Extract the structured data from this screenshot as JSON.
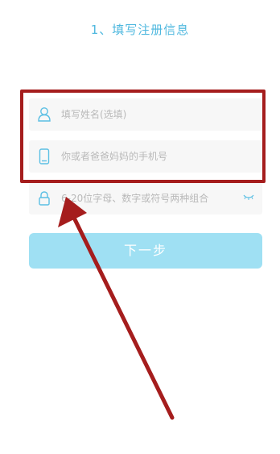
{
  "page": {
    "title": "1、填写注册信息"
  },
  "form": {
    "name_placeholder": "填写姓名(选填)",
    "phone_placeholder": "你或者爸爸妈妈的手机号",
    "password_placeholder": "6-20位字母、数字或符号两种组合",
    "next_button": "下一步"
  },
  "icons": {
    "name": "user-icon",
    "phone": "phone-icon",
    "password": "lock-icon",
    "toggle": "eye-closed-icon"
  },
  "colors": {
    "title": "#4fb8df",
    "icon": "#5bbfe4",
    "button_bg": "#9fe0f3",
    "annotation": "#a51d1d"
  }
}
